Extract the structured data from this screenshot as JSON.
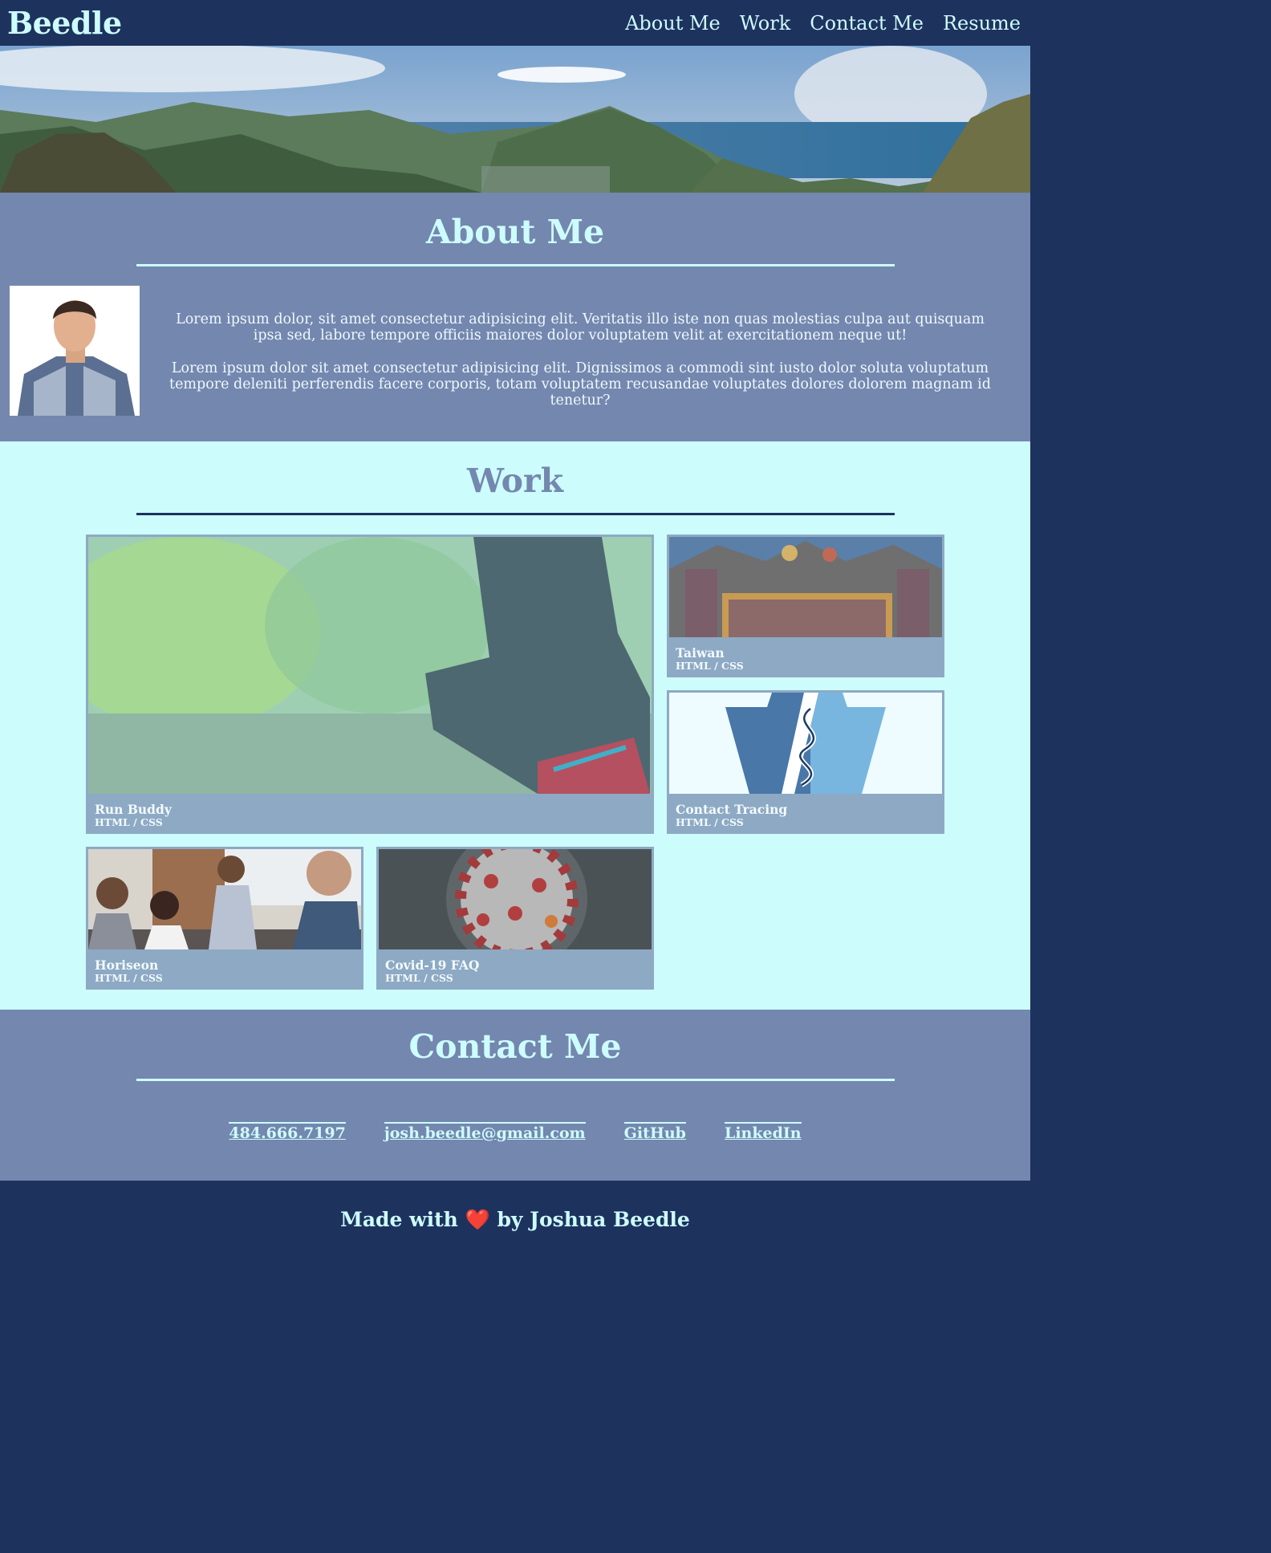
{
  "header": {
    "brand": "Beedle",
    "nav": [
      "About Me",
      "Work",
      "Contact Me",
      "Resume"
    ]
  },
  "about": {
    "title": "About Me",
    "paragraphs": [
      "Lorem ipsum dolor, sit amet consectetur adipisicing elit. Veritatis illo iste non quas molestias culpa aut quisquam ipsa sed, labore tempore officiis maiores dolor voluptatem velit at exercitationem neque ut!",
      "Lorem ipsum dolor sit amet consectetur adipisicing elit. Dignissimos a commodi sint iusto dolor soluta voluptatum tempore deleniti perferendis facere corporis, totam voluptatem recusandae voluptates dolores dolorem magnam id tenetur?"
    ]
  },
  "work": {
    "title": "Work",
    "projects": [
      {
        "title": "Run Buddy",
        "tech": "HTML / CSS"
      },
      {
        "title": "Taiwan",
        "tech": "HTML / CSS"
      },
      {
        "title": "Contact Tracing",
        "tech": "HTML / CSS"
      },
      {
        "title": "Horiseon",
        "tech": "HTML / CSS"
      },
      {
        "title": "Covid-19 FAQ",
        "tech": "HTML / CSS"
      }
    ]
  },
  "contact": {
    "title": "Contact Me",
    "links": [
      "484.666.7197",
      "josh.beedle@gmail.com",
      "GitHub",
      "LinkedIn"
    ]
  },
  "footer": {
    "prefix": "Made with",
    "heart": "❤️",
    "suffix": "by Joshua Beedle"
  },
  "colors": {
    "navy": "#1e325e",
    "slate": "#7487ae",
    "aqua": "#cdfcfd",
    "card": "#8ea9c4"
  },
  "icons": {
    "heart": "heart-icon",
    "staff": "rod-of-asclepius-icon"
  }
}
